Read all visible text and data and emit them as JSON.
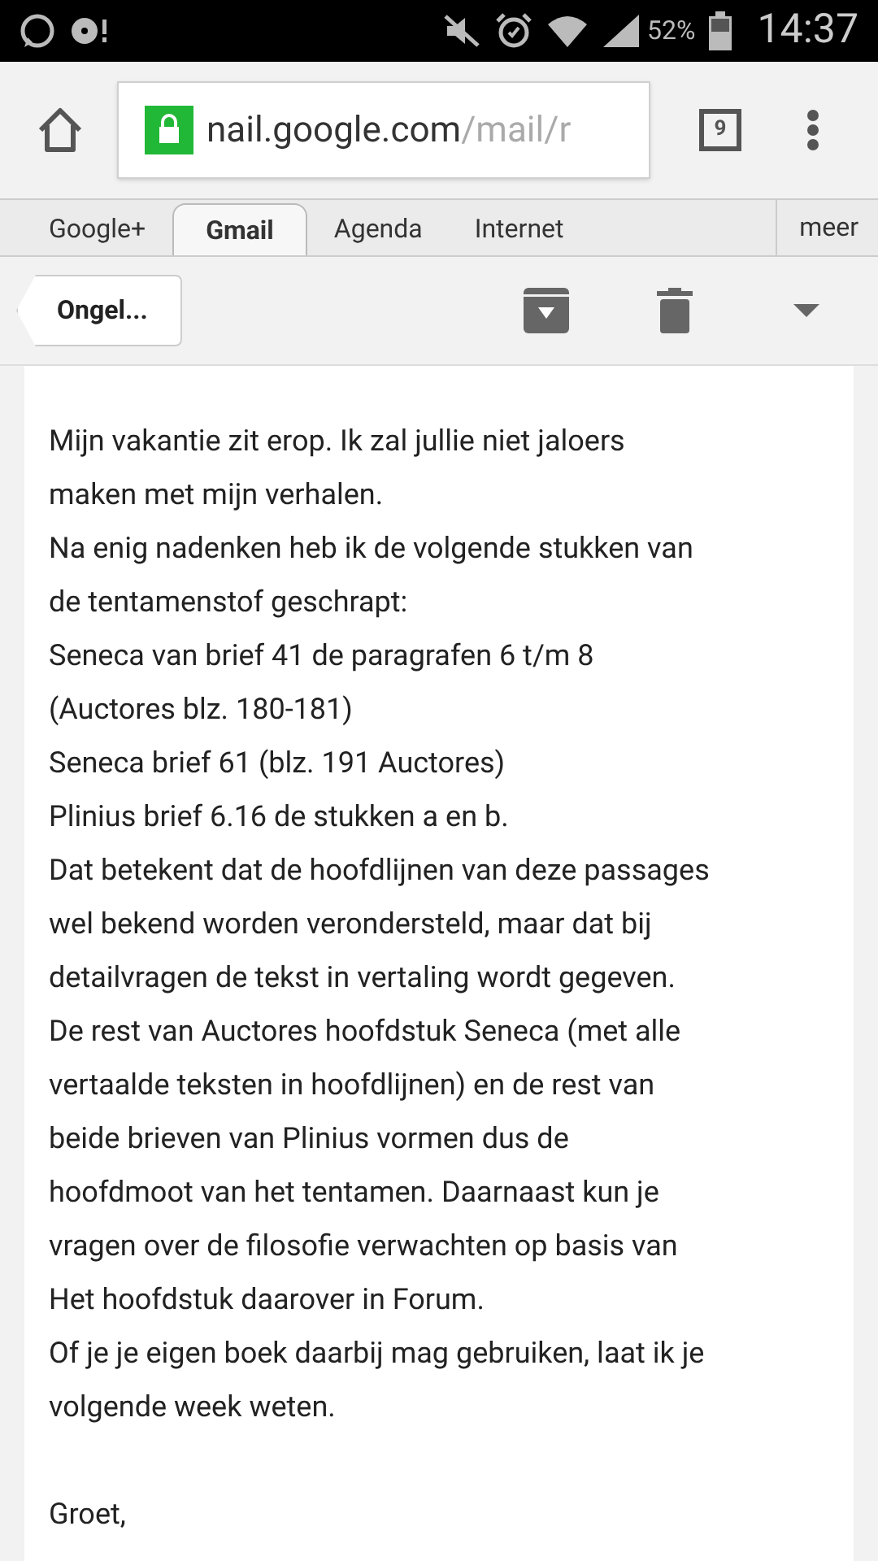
{
  "status_bar": {
    "battery": "52%",
    "time": "14:37"
  },
  "browser": {
    "url_host": "nail.google.com",
    "url_path": "/mail/r",
    "tab_count": "9"
  },
  "nav_tabs": [
    {
      "label": "Google+",
      "selected": false
    },
    {
      "label": "Gmail",
      "selected": true
    },
    {
      "label": "Agenda",
      "selected": false
    },
    {
      "label": "Internet",
      "selected": false
    }
  ],
  "more_tab": "meer",
  "toolbar": {
    "back_label": "Ongel..."
  },
  "message": {
    "paragraphs": [
      {
        "lines": [
          "Mijn vakantie zit erop. Ik zal jullie niet jaloers",
          "maken met mijn verhalen.",
          "Na enig nadenken heb ik de volgende stukken van",
          "de tentamenstof geschrapt:",
          "Seneca van brief 41 de paragrafen 6 t/m 8",
          "(Auctores blz. 180-181)",
          "Seneca brief 61 (blz. 191 Auctores)",
          "Plinius brief 6.16 de stukken a en b.",
          "Dat betekent dat de hoofdlijnen van deze passages",
          "wel bekend worden verondersteld, maar dat bij",
          "detailvragen de tekst in vertaling wordt gegeven.",
          "De rest van Auctores hoofdstuk Seneca (met alle",
          "vertaalde teksten in hoofdlijnen) en de rest van",
          "beide brieven van Plinius vormen dus de",
          "hoofdmoot van het tentamen. Daarnaast kun je",
          "vragen over de filosofie verwachten op basis van",
          "Het hoofdstuk daarover in Forum.",
          "Of je je eigen boek daarbij mag gebruiken, laat ik je",
          "volgende week weten."
        ]
      },
      {
        "lines": [
          "Groet,"
        ]
      }
    ]
  }
}
